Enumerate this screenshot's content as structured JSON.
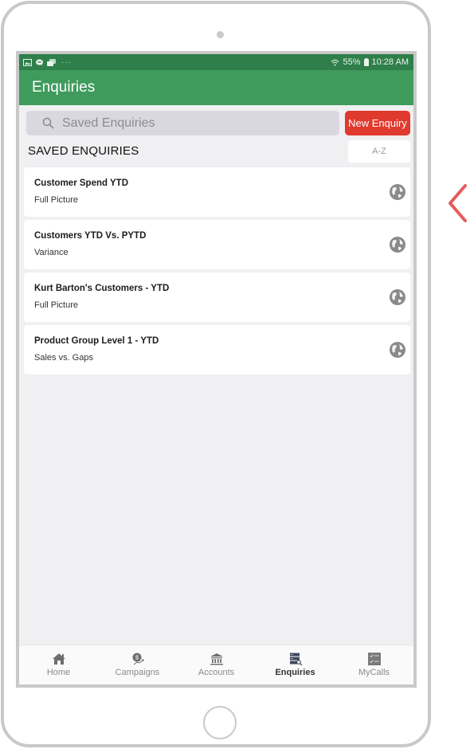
{
  "statusbar": {
    "notification_icons": [
      "gallery-icon",
      "chat-icon",
      "photos-icon"
    ],
    "more": "···",
    "battery": "55%",
    "time": "10:28 AM"
  },
  "appbar": {
    "title": "Enquiries"
  },
  "search": {
    "placeholder": "Saved Enquiries",
    "value": ""
  },
  "new_enquiry_label": "New Enquiry",
  "section": {
    "title": "SAVED ENQUIRIES",
    "sort_label": "A-Z"
  },
  "enquiries": [
    {
      "title": "Customer Spend YTD",
      "subtitle": "Full Picture",
      "icon": "globe-icon"
    },
    {
      "title": "Customers YTD Vs. PYTD",
      "subtitle": "Variance",
      "icon": "globe-icon"
    },
    {
      "title": "Kurt Barton's Customers - YTD",
      "subtitle": "Full Picture",
      "icon": "globe-icon"
    },
    {
      "title": "Product Group Level 1 - YTD",
      "subtitle": "Sales vs. Gaps",
      "icon": "globe-icon"
    }
  ],
  "nav": {
    "active": "Enquiries",
    "items": [
      {
        "label": "Home",
        "icon": "home-icon"
      },
      {
        "label": "Campaigns",
        "icon": "campaigns-icon"
      },
      {
        "label": "Accounts",
        "icon": "bank-icon"
      },
      {
        "label": "Enquiries",
        "icon": "enquiries-icon"
      },
      {
        "label": "MyCalls",
        "icon": "checklist-icon"
      }
    ]
  },
  "colors": {
    "statusbar": "#2f7f4a",
    "appbar": "#3f9b5c",
    "accent_red": "#e03a2f",
    "side_arrow": "#e85a5a",
    "background": "#f0f0f2"
  }
}
